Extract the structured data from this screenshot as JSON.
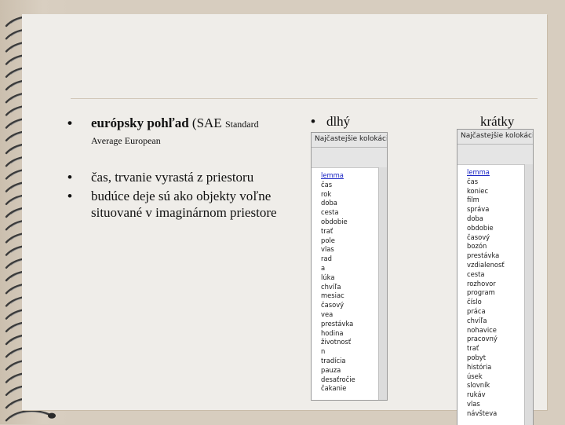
{
  "slide": {
    "bullets": [
      {
        "main": "európsky pohľad",
        "open": "(SAE",
        "small": "Standard",
        "note": "Average European"
      },
      {
        "text": "čas, trvanie vyrastá z priestoru"
      },
      {
        "text": "budúce deje sú ako objekty voľne situované v imaginárnom priestore"
      }
    ],
    "columns": {
      "left_heading": "dlhý",
      "right_heading": "krátky"
    }
  },
  "panels": {
    "left": {
      "title": "Najčastejšie kolokácie",
      "items": [
        "lemma",
        "čas",
        "rok",
        "doba",
        "cesta",
        "obdobie",
        "trať",
        "pole",
        "vlas",
        "rad",
        "a",
        "lúka",
        "chvíľa",
        "mesiac",
        "časový",
        "vea",
        "prestávka",
        "hodina",
        "životnosť",
        "n",
        "tradícia",
        "pauza",
        "desaťročie",
        "čakanie"
      ]
    },
    "right": {
      "title": "Najčastejšie kolokácie",
      "items": [
        "lemma",
        "čas",
        "koniec",
        "film",
        "správa",
        "doba",
        "obdobie",
        "časový",
        "bozón",
        "prestávka",
        "vzdialenosť",
        "cesta",
        "rozhovor",
        "program",
        "číslo",
        "práca",
        "chvíľa",
        "nohavice",
        "pracovný",
        "trať",
        "pobyt",
        "história",
        "úsek",
        "slovník",
        "rukáv",
        "vlas",
        "návšteva"
      ]
    }
  },
  "colors": {
    "background": "#d7cdbf",
    "slide": "#efede9",
    "link": "#1a25c4"
  }
}
